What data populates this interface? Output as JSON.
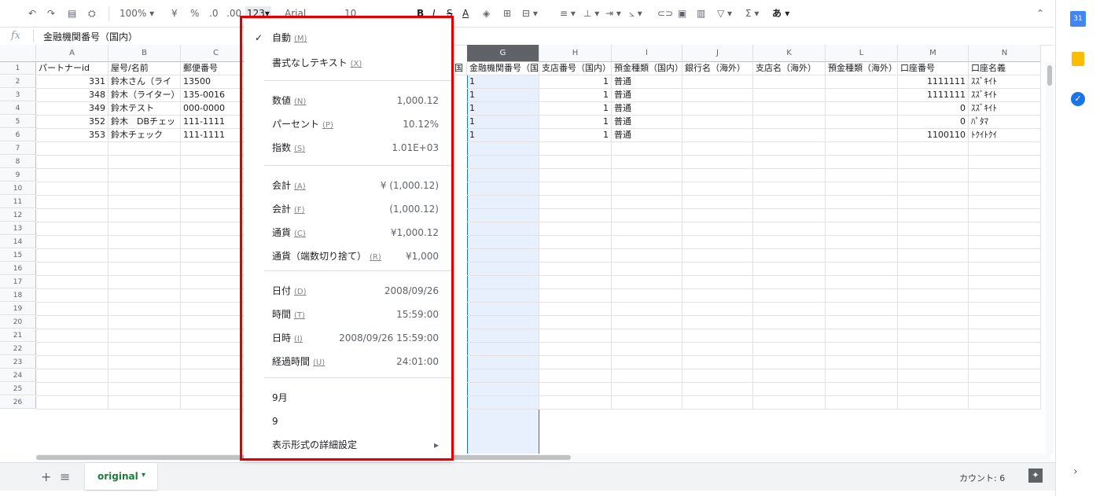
{
  "toolbar": {
    "zoom": "100%",
    "currency": "¥",
    "percent": "%",
    "decrease_decimal": ".0",
    "increase_decimal": ".00",
    "more_formats": "123",
    "font": "Arial",
    "font_size": "10",
    "bold": "B",
    "italic": "I",
    "strike": "S",
    "text_color": "A",
    "input_tools": "あ"
  },
  "formula_bar": {
    "fx": "fx",
    "content": "金融機関番号（国内）"
  },
  "columns": [
    "A",
    "B",
    "C",
    "G",
    "H",
    "I",
    "J",
    "K",
    "L",
    "M",
    "N"
  ],
  "rows": [
    "1",
    "2",
    "3",
    "4",
    "5",
    "6",
    "7",
    "8",
    "9",
    "10",
    "11",
    "12",
    "13",
    "14",
    "15",
    "16",
    "17",
    "18",
    "19",
    "20",
    "21",
    "22",
    "23",
    "24",
    "25",
    "26"
  ],
  "header_row": {
    "A": "パートナーid",
    "B": "屋号/名前",
    "C": "郵便番号",
    "partial": "国",
    "G": "金融機関番号（国",
    "H": "支店番号（国内）",
    "I": "預金種類（国内）",
    "J": "銀行名（海外）",
    "K": "支店名（海外）",
    "L": "預金種類（海外）",
    "M": "口座番号",
    "N": "口座名義"
  },
  "data_rows": [
    {
      "A": "331",
      "B": "鈴木さん（ライ",
      "C": "13500",
      "G": "1",
      "H": "1",
      "I": "普通",
      "M": "1111111",
      "N": "ｽｽﾞｷｲﾄ"
    },
    {
      "A": "348",
      "B": "鈴木（ライター）",
      "C": "135-0016",
      "G": "1",
      "H": "1",
      "I": "普通",
      "M": "1111111",
      "N": "ｽｽﾞｷｲﾄ"
    },
    {
      "A": "349",
      "B": "鈴木テスト",
      "C": "000-0000",
      "G": "1",
      "H": "1",
      "I": "普通",
      "M": "0",
      "N": "ｽｽﾞｷｲﾄ"
    },
    {
      "A": "352",
      "B": "鈴木　DBチェッ",
      "C": "111-1111",
      "G": "1",
      "H": "1",
      "I": "普通",
      "M": "0",
      "N": "ﾊﾟﾀﾏ"
    },
    {
      "A": "353",
      "B": "鈴木チェック",
      "C": "111-1111",
      "G": "1",
      "H": "1",
      "I": "普通",
      "M": "1100110",
      "N": "ﾄｸｲﾄｸｲ"
    }
  ],
  "menu": {
    "items": [
      {
        "label": "自動",
        "key": "(M)",
        "value": "",
        "checked": "✓"
      },
      {
        "label": "書式なしテキスト",
        "key": "(X)",
        "value": ""
      },
      {
        "label": "数値",
        "key": "(N)",
        "value": "1,000.12"
      },
      {
        "label": "パーセント",
        "key": "(P)",
        "value": "10.12%"
      },
      {
        "label": "指数",
        "key": "(S)",
        "value": "1.01E+03"
      },
      {
        "label": "会計",
        "key": "(A)",
        "value": "¥ (1,000.12)"
      },
      {
        "label": "会計",
        "key": "(F)",
        "value": "(1,000.12)"
      },
      {
        "label": "通貨",
        "key": "(C)",
        "value": "¥1,000.12"
      },
      {
        "label": "通貨（端数切り捨て）",
        "key": "(R)",
        "value": "¥1,000"
      },
      {
        "label": "日付",
        "key": "(D)",
        "value": "2008/09/26"
      },
      {
        "label": "時間",
        "key": "(T)",
        "value": "15:59:00"
      },
      {
        "label": "日時",
        "key": "(I)",
        "value": "2008/09/26 15:59:00"
      },
      {
        "label": "経過時間",
        "key": "(U)",
        "value": "24:01:00"
      },
      {
        "label": "9月",
        "key": "",
        "value": ""
      },
      {
        "label": "9",
        "key": "",
        "value": ""
      },
      {
        "label": "表示形式の詳細設定",
        "key": "",
        "value": "▸"
      }
    ]
  },
  "bottom": {
    "add": "+",
    "sheets_menu": "≡",
    "sheet_name": "original",
    "sheet_arrow": "▾",
    "status": "カウント: 6",
    "expand": "›"
  },
  "colors": {
    "accent": "#188038",
    "selection": "#e8f0fe",
    "highlight_border": "#e00000"
  }
}
